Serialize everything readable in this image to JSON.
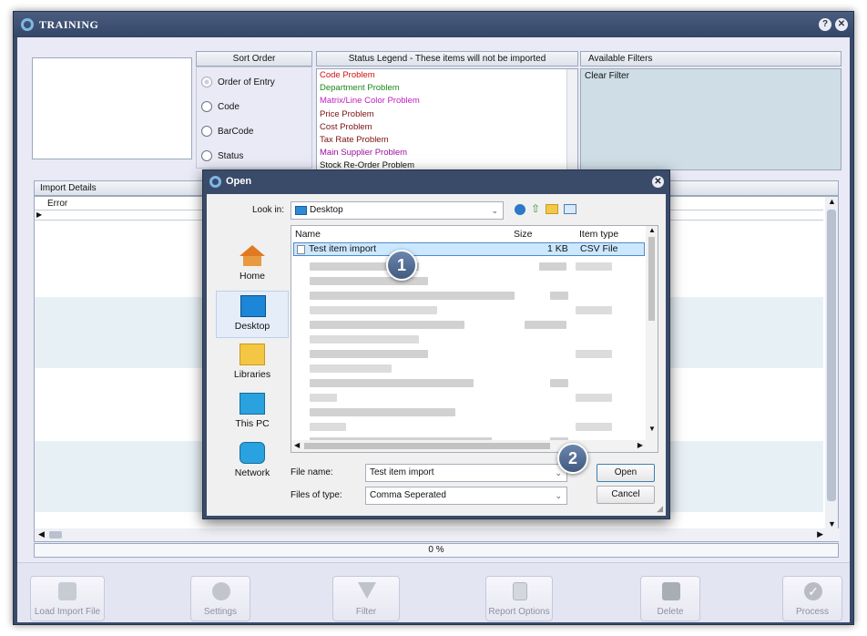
{
  "app": {
    "title": "TRAINING",
    "help_glyph": "?",
    "close_glyph": "✕"
  },
  "sort_order": {
    "header": "Sort Order",
    "options": [
      "Order of Entry",
      "Code",
      "BarCode",
      "Status"
    ],
    "selected": "Order of Entry"
  },
  "status_legend": {
    "header": "Status Legend - These items will not be imported",
    "items": [
      {
        "label": "Code Problem",
        "color": "#d01010"
      },
      {
        "label": "Department Problem",
        "color": "#1a8a1a"
      },
      {
        "label": "Matrix/Line Color Problem",
        "color": "#c020c0"
      },
      {
        "label": "Price Problem",
        "color": "#7a1010"
      },
      {
        "label": "Cost Problem",
        "color": "#7a1010"
      },
      {
        "label": "Tax Rate Problem",
        "color": "#7a1010"
      },
      {
        "label": "Main Supplier Problem",
        "color": "#9a10a0"
      },
      {
        "label": "Stock Re-Order Problem",
        "color": "#111111"
      }
    ]
  },
  "filters": {
    "header": "Available Filters",
    "items": [
      "Clear Filter"
    ]
  },
  "import_details": {
    "header": "Import Details",
    "columns": [
      "Error"
    ]
  },
  "progress": {
    "text": "0 %",
    "value": 0
  },
  "toolbar": [
    {
      "label": "Load Import File",
      "icon": "spreadsheet-import-icon"
    },
    {
      "label": "Settings",
      "icon": "gear-icon"
    },
    {
      "label": "Filter",
      "icon": "funnel-icon"
    },
    {
      "label": "Report Options",
      "icon": "report-icon"
    },
    {
      "label": "Delete",
      "icon": "trash-icon"
    },
    {
      "label": "Process",
      "icon": "checkmark-icon"
    }
  ],
  "open_dialog": {
    "title": "Open",
    "look_in_label": "Look in:",
    "look_in_value": "Desktop",
    "places": [
      "Home",
      "Desktop",
      "Libraries",
      "This PC",
      "Network"
    ],
    "selected_place": "Desktop",
    "columns": [
      "Name",
      "Size",
      "Item type"
    ],
    "selected_file": {
      "name": "Test item import",
      "size": "1 KB",
      "type": "CSV File"
    },
    "file_name_label": "File name:",
    "file_name_value": "Test item import",
    "files_of_type_label": "Files of type:",
    "files_of_type_value": "Comma Seperated",
    "open_button": "Open",
    "cancel_button": "Cancel"
  },
  "callouts": [
    "1",
    "2"
  ]
}
